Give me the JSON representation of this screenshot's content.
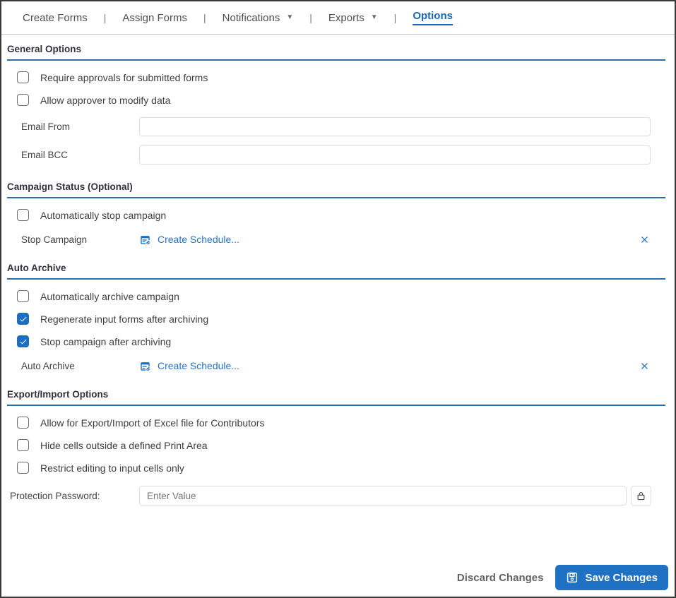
{
  "nav": {
    "separator": "|",
    "dropdown_icon": "▼",
    "items": [
      {
        "label": "Create Forms"
      },
      {
        "label": "Assign Forms"
      },
      {
        "label": "Notifications"
      },
      {
        "label": "Exports"
      },
      {
        "label": "Options"
      }
    ]
  },
  "sections": {
    "general": {
      "title": "General Options",
      "checkboxes": [
        {
          "label": "Require approvals for submitted forms",
          "checked": false
        },
        {
          "label": "Allow approver to modify data",
          "checked": false
        }
      ],
      "fields": [
        {
          "label": "Email From",
          "value": "",
          "placeholder": ""
        },
        {
          "label": "Email BCC",
          "value": "",
          "placeholder": ""
        }
      ]
    },
    "campaign_status": {
      "title": "Campaign Status (Optional)",
      "checkboxes": [
        {
          "label": "Automatically stop campaign",
          "checked": false
        }
      ],
      "schedule": {
        "label": "Stop Campaign",
        "link": "Create Schedule..."
      }
    },
    "auto_archive": {
      "title": "Auto Archive",
      "checkboxes": [
        {
          "label": "Automatically archive campaign",
          "checked": false
        },
        {
          "label": "Regenerate input forms after archiving",
          "checked": true
        },
        {
          "label": "Stop campaign after archiving",
          "checked": true
        }
      ],
      "schedule": {
        "label": "Auto Archive",
        "link": "Create Schedule..."
      }
    },
    "export_import": {
      "title": "Export/Import Options",
      "checkboxes": [
        {
          "label": "Allow for Export/Import of Excel file for Contributors",
          "checked": false
        },
        {
          "label": "Hide cells outside a defined Print Area",
          "checked": false
        },
        {
          "label": "Restrict editing to input cells only",
          "checked": false
        }
      ],
      "password_field": {
        "label": "Protection Password:",
        "value": "",
        "placeholder": "Enter Value"
      }
    }
  },
  "footer": {
    "discard_label": "Discard Changes",
    "save_label": "Save Changes"
  },
  "colors": {
    "accent_blue": "#1b6ec2",
    "link_blue": "#2573c9",
    "nav_active_blue": "#1b66b5",
    "section_underline": "#2d6da6",
    "save_button_bg": "#1f71c4"
  }
}
